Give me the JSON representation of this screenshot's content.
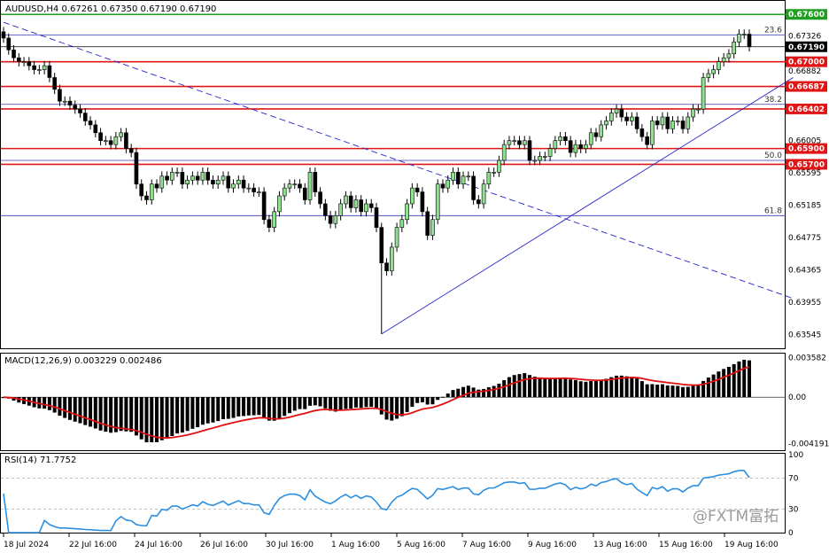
{
  "window": {
    "symbol_header": "AUDUSD,H4  0.67261  0.67350  0.67190  0.67190",
    "watermark": "@FXTM富拓"
  },
  "chart_data": [
    {
      "type": "candlestick",
      "symbol": "AUDUSD",
      "timeframe": "H4",
      "ohlc_header": {
        "open": 0.67261,
        "high": 0.6735,
        "low": 0.6719,
        "close": 0.6719
      },
      "ylim": [
        0.6338,
        0.6776
      ],
      "y_ticks": [
        "0.67600",
        "0.67326",
        "0.67190",
        "0.67000",
        "0.66882",
        "0.66687",
        "0.66402",
        "0.66005",
        "0.65900",
        "0.65700",
        "0.65595",
        "0.65185",
        "0.64775",
        "0.64365",
        "0.63955",
        "0.63545"
      ],
      "x_ticks": [
        "18 Jul 2024",
        "22 Jul 16:00",
        "24 Jul 16:00",
        "26 Jul 16:00",
        "30 Jul 16:00",
        "1 Aug 16:00",
        "5 Aug 16:00",
        "7 Aug 16:00",
        "9 Aug 16:00",
        "13 Aug 16:00",
        "15 Aug 16:00",
        "19 Aug 16:00"
      ],
      "highlighted_prices": [
        {
          "label": "0.67600",
          "value": 0.676,
          "color": "#1f9e1f"
        },
        {
          "label": "0.67190",
          "value": 0.6719,
          "color": "#000000"
        }
      ],
      "support_resistance": [
        {
          "label": "0.67000",
          "value": 0.67
        },
        {
          "label": "0.66687",
          "value": 0.66687
        },
        {
          "label": "0.66402",
          "value": 0.66402
        },
        {
          "label": "0.65900",
          "value": 0.659
        },
        {
          "label": "0.65700",
          "value": 0.657
        }
      ],
      "fibonacci": [
        {
          "label": "23.6",
          "value": 0.6734
        },
        {
          "label": "38.2",
          "value": 0.6646
        },
        {
          "label": "50.0",
          "value": 0.6575
        },
        {
          "label": "61.8",
          "value": 0.6505
        }
      ],
      "trendlines": [
        {
          "from": [
            0,
            0.675
          ],
          "to": [
            148,
            0.64
          ],
          "style": "dashed"
        },
        {
          "from": [
            74,
            0.6355
          ],
          "to": [
            148,
            0.668
          ],
          "style": "solid"
        }
      ],
      "closes": [
        0.673,
        0.6715,
        0.6705,
        0.67,
        0.67,
        0.6695,
        0.669,
        0.669,
        0.6695,
        0.668,
        0.6665,
        0.665,
        0.665,
        0.6645,
        0.664,
        0.6635,
        0.6625,
        0.662,
        0.661,
        0.66,
        0.66,
        0.6595,
        0.6605,
        0.661,
        0.659,
        0.6585,
        0.6545,
        0.653,
        0.6525,
        0.6545,
        0.654,
        0.6555,
        0.655,
        0.656,
        0.656,
        0.6545,
        0.655,
        0.6555,
        0.655,
        0.656,
        0.655,
        0.6545,
        0.655,
        0.6555,
        0.654,
        0.6545,
        0.655,
        0.654,
        0.654,
        0.6535,
        0.6535,
        0.65,
        0.649,
        0.651,
        0.653,
        0.654,
        0.6545,
        0.6545,
        0.654,
        0.6525,
        0.656,
        0.6535,
        0.652,
        0.6505,
        0.6495,
        0.6505,
        0.652,
        0.653,
        0.6515,
        0.6525,
        0.651,
        0.652,
        0.6515,
        0.649,
        0.6445,
        0.6435,
        0.6465,
        0.649,
        0.65,
        0.652,
        0.654,
        0.6535,
        0.651,
        0.648,
        0.65,
        0.6545,
        0.654,
        0.655,
        0.656,
        0.6545,
        0.6555,
        0.6555,
        0.6525,
        0.652,
        0.6545,
        0.656,
        0.656,
        0.6575,
        0.6595,
        0.66,
        0.66,
        0.6595,
        0.66,
        0.6575,
        0.6575,
        0.658,
        0.658,
        0.659,
        0.66,
        0.6605,
        0.66,
        0.6585,
        0.6595,
        0.659,
        0.6595,
        0.661,
        0.6605,
        0.662,
        0.6625,
        0.6635,
        0.664,
        0.663,
        0.6625,
        0.663,
        0.6615,
        0.6605,
        0.6595,
        0.6625,
        0.662,
        0.663,
        0.6615,
        0.6625,
        0.6625,
        0.6615,
        0.663,
        0.664,
        0.664,
        0.668,
        0.6685,
        0.669,
        0.67,
        0.6705,
        0.671,
        0.6725,
        0.6735,
        0.6735,
        0.6719
      ]
    },
    {
      "type": "bar+line",
      "indicator": "MACD",
      "label": "MACD(12,26,9)  0.003229  0.002486",
      "ylim": [
        -0.0047,
        0.00385
      ],
      "y_ticks": [
        "0.003582",
        "0.00",
        "-0.004191"
      ],
      "signal_color": "#e01010"
    },
    {
      "type": "line",
      "indicator": "RSI",
      "label": "RSI(14)  71.7752",
      "ylim": [
        0,
        100
      ],
      "y_ticks": [
        "100",
        "70",
        "30",
        "0"
      ],
      "levels": [
        70,
        30
      ],
      "line_color": "#2b8fe0"
    }
  ]
}
